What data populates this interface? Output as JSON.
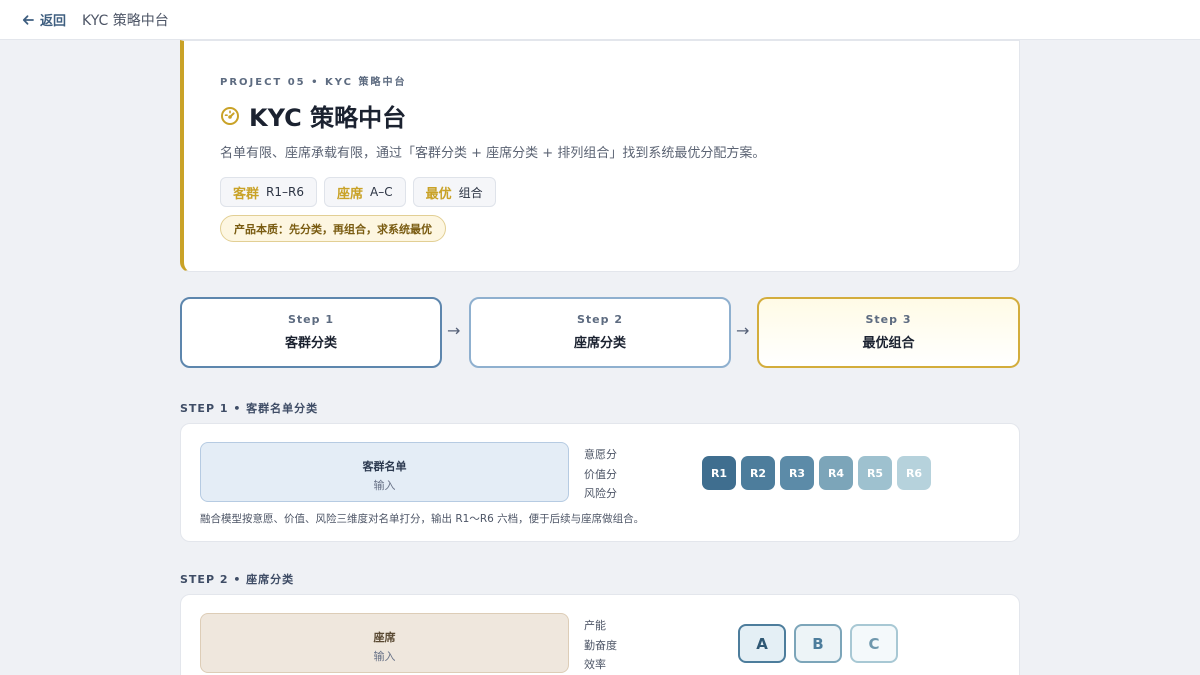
{
  "topbar": {
    "back_label": "返回",
    "title": "KYC 策略中台"
  },
  "hero": {
    "eyebrow": "PROJECT 05 • KYC 策略中台",
    "title": "KYC 策略中台",
    "description": "名单有限、座席承载有限，通过「客群分类 + 座席分类 + 排列组合」找到系统最优分配方案。",
    "tags": [
      {
        "key": "客群",
        "value": "R1–R6"
      },
      {
        "key": "座席",
        "value": "A–C"
      },
      {
        "key": "最优",
        "value": "组合"
      }
    ],
    "badge": "产品本质：先分类，再组合，求系统最优"
  },
  "steps": [
    {
      "num": "Step 1",
      "label": "客群分类"
    },
    {
      "num": "Step 2",
      "label": "座席分类"
    },
    {
      "num": "Step 3",
      "label": "最优组合"
    }
  ],
  "arrows": [
    "→",
    "→"
  ],
  "section1": {
    "label": "STEP 1 • 客群名单分类",
    "input_title": "客群名单",
    "input_sub": "输入",
    "criteria": [
      "意愿分",
      "价值分",
      "风险分"
    ],
    "ranks": [
      {
        "label": "R1",
        "color": "#3f6e8f"
      },
      {
        "label": "R2",
        "color": "#4d7d9c"
      },
      {
        "label": "R3",
        "color": "#5c8ba8"
      },
      {
        "label": "R4",
        "color": "#7ca5b9"
      },
      {
        "label": "R5",
        "color": "#9ec1cf"
      },
      {
        "label": "R6",
        "color": "#b6d2dc"
      }
    ],
    "note": "融合模型按意愿、价值、风险三维度对名单打分，输出 R1～R6 六档，便于后续与座席做组合。"
  },
  "section2": {
    "label": "STEP 2 • 座席分类",
    "input_title": "座席",
    "input_sub": "输入",
    "criteria": [
      "产能",
      "勤奋度",
      "效率"
    ],
    "seats": [
      {
        "label": "A",
        "border": "#4d7d9c",
        "bg": "#e4eff5",
        "color": "#2f5874"
      },
      {
        "label": "B",
        "border": "#7ca5b9",
        "bg": "#edf4f7",
        "color": "#4d7d9c"
      },
      {
        "label": "C",
        "border": "#a8c8d4",
        "bg": "#f4f9fb",
        "color": "#6f98ad"
      }
    ]
  },
  "colors": {
    "accent_gold": "#c9a227",
    "primary_blue": "#5d86ad"
  }
}
